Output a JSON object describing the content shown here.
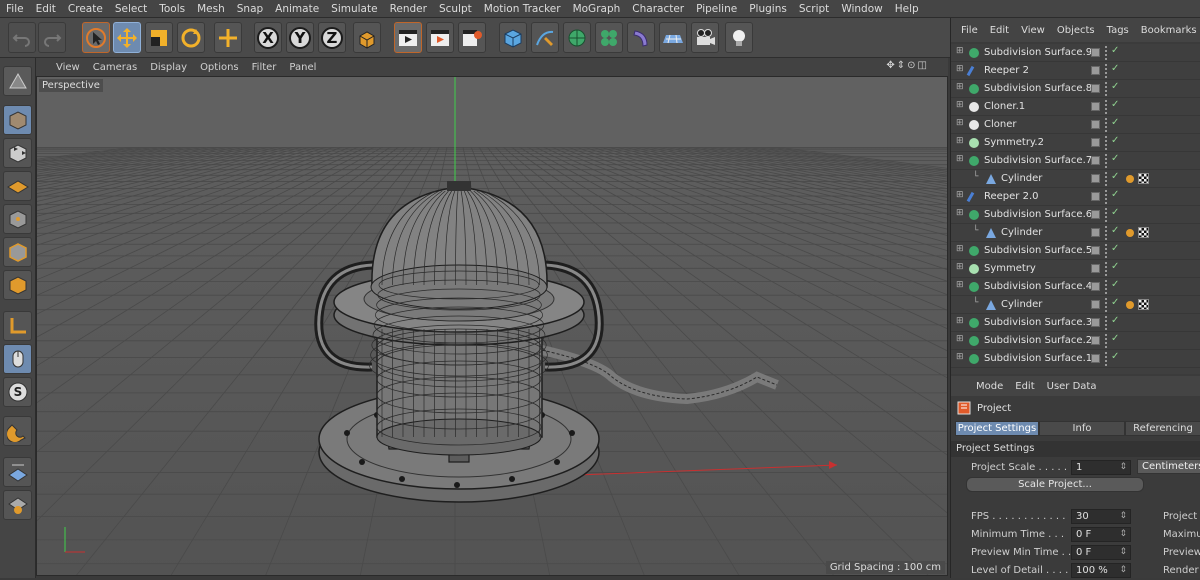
{
  "menu": [
    "File",
    "Edit",
    "Create",
    "Select",
    "Tools",
    "Mesh",
    "Snap",
    "Animate",
    "Simulate",
    "Render",
    "Sculpt",
    "Motion Tracker",
    "MoGraph",
    "Character",
    "Pipeline",
    "Plugins",
    "Script",
    "Window",
    "Help"
  ],
  "toolbar": {
    "icons": [
      "undo-icon",
      "redo-icon",
      "select-icon",
      "move-icon",
      "scale-icon",
      "rotate-icon",
      "add-icon",
      "x-axis-icon",
      "y-axis-icon",
      "z-axis-icon",
      "coordinate-system-icon",
      "render-view-icon",
      "render-picture-viewer-icon",
      "render-settings-icon",
      "cube-icon",
      "pen-icon",
      "subdivision-icon",
      "cloner-icon",
      "deformer-icon",
      "floor-icon",
      "camera-icon",
      "light-icon"
    ],
    "axis_x": "X",
    "axis_y": "Y",
    "axis_z": "Z"
  },
  "viewport": {
    "menu": [
      "View",
      "Cameras",
      "Display",
      "Options",
      "Filter",
      "Panel"
    ],
    "label": "Perspective",
    "grid_spacing": "Grid Spacing : 100 cm",
    "nav_icons": "✥⇕⊙◫"
  },
  "object_manager": {
    "menu": [
      "File",
      "Edit",
      "View",
      "Objects",
      "Tags",
      "Bookmarks"
    ],
    "objects": [
      {
        "name": "Subdivision Surface.9",
        "indent": 0,
        "kind": "subdiv",
        "tags": false
      },
      {
        "name": "Reeper 2",
        "indent": 0,
        "kind": "spline",
        "tags": false
      },
      {
        "name": "Subdivision Surface.8",
        "indent": 0,
        "kind": "subdiv",
        "tags": false
      },
      {
        "name": "Cloner.1",
        "indent": 0,
        "kind": "cloner",
        "tags": false
      },
      {
        "name": "Cloner",
        "indent": 0,
        "kind": "cloner",
        "tags": false
      },
      {
        "name": "Symmetry.2",
        "indent": 0,
        "kind": "symmetry",
        "tags": false
      },
      {
        "name": "Subdivision Surface.7",
        "indent": 0,
        "kind": "subdiv",
        "tags": false
      },
      {
        "name": "Cylinder",
        "indent": 1,
        "kind": "cylinder",
        "tags": true
      },
      {
        "name": "Reeper 2.0",
        "indent": 0,
        "kind": "spline",
        "tags": false
      },
      {
        "name": "Subdivision Surface.6",
        "indent": 0,
        "kind": "subdiv",
        "tags": false
      },
      {
        "name": "Cylinder",
        "indent": 1,
        "kind": "cylinder",
        "tags": true
      },
      {
        "name": "Subdivision Surface.5",
        "indent": 0,
        "kind": "subdiv",
        "tags": false
      },
      {
        "name": "Symmetry",
        "indent": 0,
        "kind": "symmetry",
        "tags": false
      },
      {
        "name": "Subdivision Surface.4",
        "indent": 0,
        "kind": "subdiv",
        "tags": false
      },
      {
        "name": "Cylinder",
        "indent": 1,
        "kind": "cylinder",
        "tags": true
      },
      {
        "name": "Subdivision Surface.3",
        "indent": 0,
        "kind": "subdiv",
        "tags": false
      },
      {
        "name": "Subdivision Surface.2",
        "indent": 0,
        "kind": "subdiv",
        "tags": false
      },
      {
        "name": "Subdivision Surface.1",
        "indent": 0,
        "kind": "subdiv",
        "tags": false
      }
    ]
  },
  "attributes": {
    "menu": [
      "Mode",
      "Edit",
      "User Data"
    ],
    "header": "Project",
    "tabs": [
      "Project Settings",
      "Info",
      "Referencing"
    ],
    "section": "Project Settings",
    "project_scale_label": "Project Scale . . . . . .",
    "project_scale_value": "1",
    "project_scale_unit": "Centimeters",
    "scale_button": "Scale Project...",
    "rows": [
      {
        "label": "FPS . . . . . . . . . . . .",
        "value": "30",
        "right": "Project T"
      },
      {
        "label": "Minimum Time . . .",
        "value": "0 F",
        "right": "Maximu"
      },
      {
        "label": "Preview Min Time . .",
        "value": "0 F",
        "right": "Preview"
      },
      {
        "label": "Level of Detail . . . .",
        "value": "100 %",
        "right": "Render"
      }
    ]
  },
  "colors": {
    "accent": "#6e8bb0",
    "subdiv": "#3fa86a",
    "cloner": "#e8e8e8",
    "spline": "#4a7fd4",
    "cylinder": "#7aa8e0"
  }
}
